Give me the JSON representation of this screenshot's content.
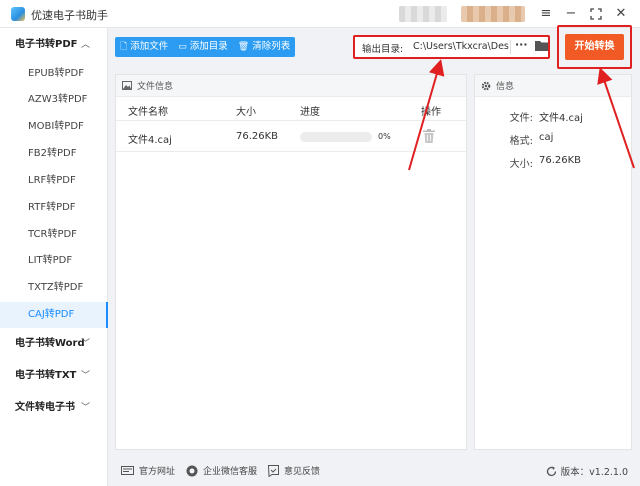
{
  "app": {
    "title": "优速电子书助手"
  },
  "window": {
    "menu_icon": "hamburger-icon",
    "minimize_icon": "minimize-icon",
    "maximize_icon": "maximize-icon",
    "close_icon": "close-icon"
  },
  "sidebar": {
    "groups": [
      {
        "label": "电子书转PDF",
        "expanded": true
      },
      {
        "label": "电子书转Word",
        "expanded": false
      },
      {
        "label": "电子书转TXT",
        "expanded": false
      },
      {
        "label": "文件转电子书",
        "expanded": false
      }
    ],
    "items": [
      "EPUB转PDF",
      "AZW3转PDF",
      "MOBI转PDF",
      "FB2转PDF",
      "LRF转PDF",
      "RTF转PDF",
      "TCR转PDF",
      "LIT转PDF",
      "TXTZ转PDF",
      "CAJ转PDF"
    ],
    "active_item": "CAJ转PDF"
  },
  "toolbar": {
    "add_file": "添加文件",
    "add_folder": "添加目录",
    "clear_list": "清除列表",
    "output_label": "输出目录:",
    "output_path": "C:\\Users\\Tkxcra\\Desktc",
    "more": "···",
    "start": "开始转换"
  },
  "file_panel": {
    "title": "文件信息",
    "columns": [
      "文件名称",
      "大小",
      "进度",
      "操作"
    ],
    "rows": [
      {
        "name": "文件4.caj",
        "size": "76.26KB",
        "progress": 0,
        "progress_text": "0%"
      }
    ]
  },
  "info_panel": {
    "title": "信息",
    "file_label": "文件:",
    "file_value": "文件4.caj",
    "format_label": "格式:",
    "format_value": "caj",
    "size_label": "大小:",
    "size_value": "76.26KB"
  },
  "footer": {
    "website": "官方网址",
    "wechat": "企业微信客服",
    "feedback": "意见反馈",
    "version": "版本：v1.2.1.0"
  },
  "colors": {
    "accent": "#2b9cf2",
    "start": "#f15a24",
    "highlight": "#e02020",
    "active_bg": "#e8f3fd"
  }
}
